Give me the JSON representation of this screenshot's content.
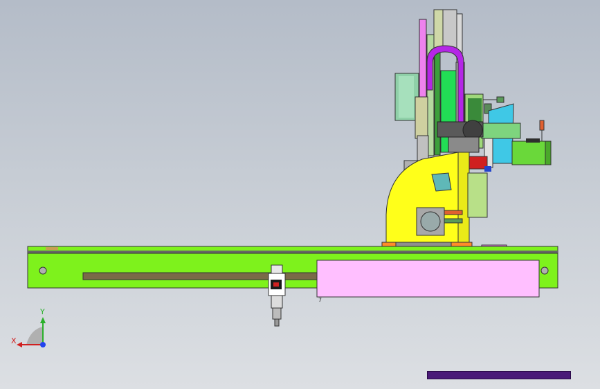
{
  "axes": {
    "x_label": "X",
    "y_label": "Y"
  },
  "colors": {
    "beam": "#7ef21c",
    "beam_slot": "#7a6a48",
    "cover_panel": "#ffbfff",
    "carriage": "#ffff1a",
    "cable_loop": "#b426e6",
    "mast_pink": "#ee82ee",
    "column_green": "#22dd55",
    "motor_blue": "#3fc8e6",
    "motor_green": "#6ad83a",
    "progress_bar": "#4a1a78"
  },
  "icons": [
    "triad-icon",
    "spindle-icon"
  ],
  "part_label": "7"
}
